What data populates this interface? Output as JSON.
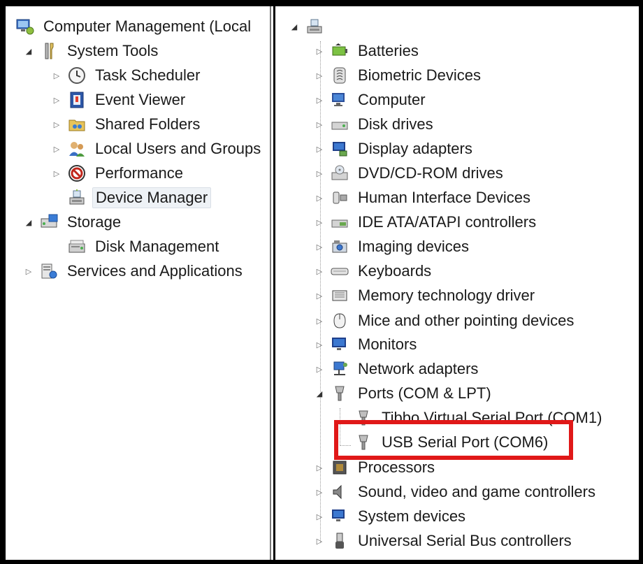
{
  "left_tree": {
    "root": "Computer Management (Local",
    "system_tools": "System Tools",
    "task_scheduler": "Task Scheduler",
    "event_viewer": "Event Viewer",
    "shared_folders": "Shared Folders",
    "local_users": "Local Users and Groups",
    "performance": "Performance",
    "device_manager": "Device Manager",
    "storage": "Storage",
    "disk_management": "Disk Management",
    "services": "Services and Applications"
  },
  "device_tree": {
    "categories": [
      "Batteries",
      "Biometric Devices",
      "Computer",
      "Disk drives",
      "Display adapters",
      "DVD/CD-ROM drives",
      "Human Interface Devices",
      "IDE ATA/ATAPI controllers",
      "Imaging devices",
      "Keyboards",
      "Memory technology driver",
      "Mice and other pointing devices",
      "Monitors",
      "Network adapters",
      "Ports (COM & LPT)",
      "Processors",
      "Sound, video and game controllers",
      "System devices",
      "Universal Serial Bus controllers"
    ],
    "ports_children": [
      "Tibbo Virtual Serial Port (COM1)",
      "USB Serial Port (COM6)"
    ]
  },
  "colors": {
    "highlight": "#e01818",
    "selection": "#eef2f6"
  }
}
